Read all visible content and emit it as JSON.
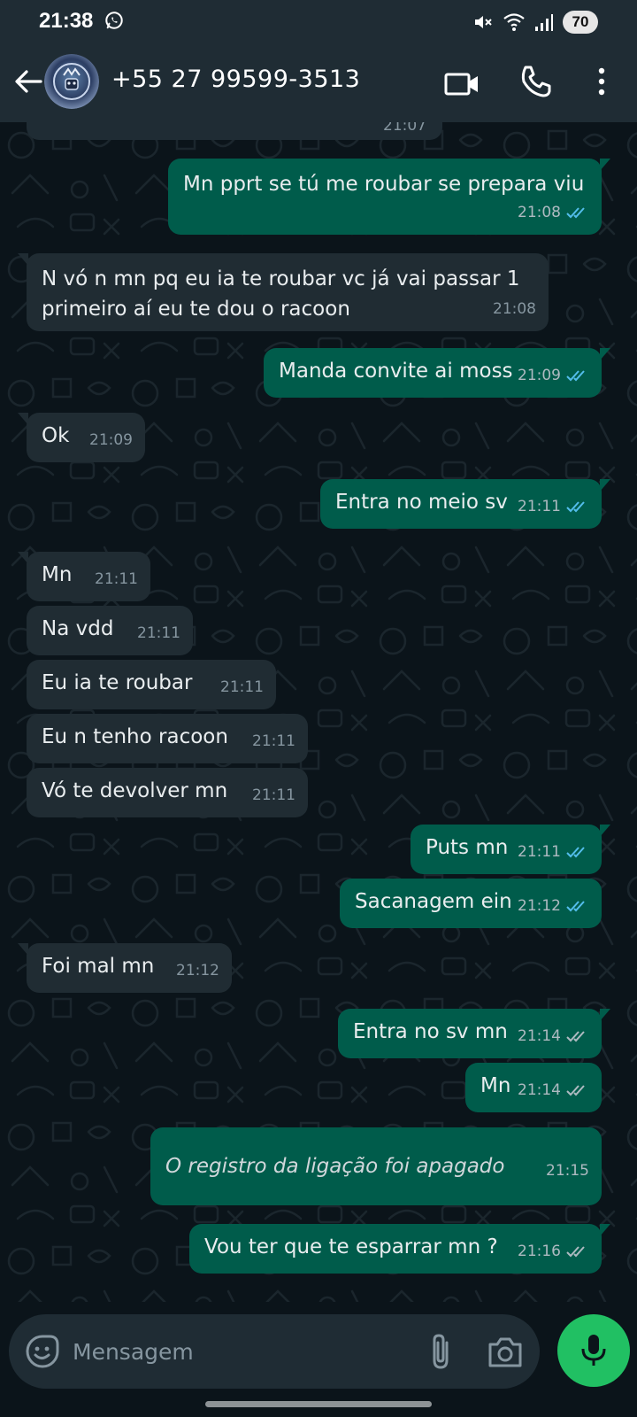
{
  "status_bar": {
    "time": "21:38",
    "battery": "70",
    "icons": [
      "whatsapp-icon",
      "mute-icon",
      "wifi-icon",
      "signal-icon",
      "battery-icon"
    ]
  },
  "header": {
    "contact": "+55 27 99599-3513",
    "icons": [
      "back-arrow-icon",
      "video-call-icon",
      "voice-call-icon",
      "more-options-icon"
    ]
  },
  "chat": {
    "previous_time": "21:07",
    "messages": [
      {
        "direction": "out",
        "text": "Mn pprt se tú me roubar se prepara viu",
        "time": "21:08",
        "status": "read"
      },
      {
        "direction": "in",
        "text": "N vó n mn pq eu ia te roubar vc já vai passar 1 primeiro aí eu te dou o racoon",
        "time": "21:08"
      },
      {
        "direction": "out",
        "text": "Manda convite ai moss",
        "time": "21:09",
        "status": "read"
      },
      {
        "direction": "in",
        "text": "Ok",
        "time": "21:09"
      },
      {
        "direction": "out",
        "text": "Entra no meio sv",
        "time": "21:11",
        "status": "read"
      },
      {
        "direction": "in",
        "text": "Mn",
        "time": "21:11"
      },
      {
        "direction": "in",
        "text": "Na vdd",
        "time": "21:11"
      },
      {
        "direction": "in",
        "text": "Eu ia te roubar",
        "time": "21:11"
      },
      {
        "direction": "in",
        "text": "Eu n tenho racoon",
        "time": "21:11"
      },
      {
        "direction": "in",
        "text": "Vó te devolver mn",
        "time": "21:11"
      },
      {
        "direction": "out",
        "text": "Puts mn",
        "time": "21:11",
        "status": "read"
      },
      {
        "direction": "out",
        "text": "Sacanagem ein",
        "time": "21:12",
        "status": "read"
      },
      {
        "direction": "in",
        "text": "Foi mal mn",
        "time": "21:12"
      },
      {
        "direction": "out",
        "text": "Entra no sv mn",
        "time": "21:14",
        "status": "delivered"
      },
      {
        "direction": "out",
        "text": "Mn",
        "time": "21:14",
        "status": "delivered"
      },
      {
        "direction": "out",
        "text": "O registro da ligação foi apagado",
        "time": "21:15",
        "status": "none"
      },
      {
        "direction": "out",
        "text": "Vou ter que te esparrar mn ?",
        "time": "21:16",
        "status": "delivered"
      }
    ]
  },
  "composer": {
    "placeholder": "Mensagem",
    "icons": [
      "emoji-icon",
      "attach-icon",
      "camera-icon",
      "mic-icon"
    ]
  },
  "colors": {
    "outgoing_bubble": "#005c4b",
    "incoming_bubble": "#202c33",
    "background": "#0b141a",
    "header": "#1f2c34",
    "read_tick": "#53bdeb",
    "delivered_tick": "#aebac1",
    "mic_button": "#21c063"
  }
}
